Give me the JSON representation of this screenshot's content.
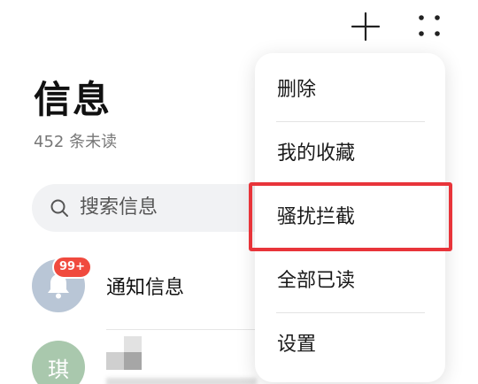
{
  "header": {
    "add_icon": "plus-icon",
    "more_icon": "more-dots-icon"
  },
  "page": {
    "title": "信息",
    "unread_summary": "452 条未读"
  },
  "search": {
    "icon": "search-icon",
    "placeholder": "搜索信息"
  },
  "conversations": [
    {
      "name": "通知信息",
      "avatar_icon": "bell-icon",
      "avatar_color": "#b9c6d6",
      "badge": "99+"
    },
    {
      "avatar_text": "琪",
      "avatar_color": "#a9c8ad"
    }
  ],
  "menu": {
    "items": [
      {
        "label": "删除"
      },
      {
        "label": "我的收藏"
      },
      {
        "label": "骚扰拦截",
        "highlighted": true
      },
      {
        "label": "全部已读"
      },
      {
        "label": "设置"
      }
    ]
  },
  "colors": {
    "highlight_border": "#e8343a",
    "badge": "#f04a3e",
    "search_bg": "#f1f2f4",
    "text_primary": "#111111",
    "text_secondary": "#777777"
  }
}
